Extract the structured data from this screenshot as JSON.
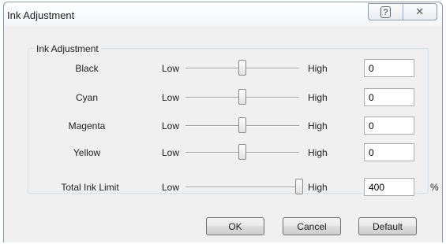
{
  "window": {
    "title": "Ink Adjustment",
    "help_button_glyph": "?",
    "close_button_glyph": "✕"
  },
  "group": {
    "label": "Ink Adjustment"
  },
  "rows": [
    {
      "label": "Black",
      "low": "Low",
      "high": "High",
      "value": "0",
      "slider_level": 0.5
    },
    {
      "label": "Cyan",
      "low": "Low",
      "high": "High",
      "value": "0",
      "slider_level": 0.5
    },
    {
      "label": "Magenta",
      "low": "Low",
      "high": "High",
      "value": "0",
      "slider_level": 0.5
    },
    {
      "label": "Yellow",
      "low": "Low",
      "high": "High",
      "value": "0",
      "slider_level": 0.5
    }
  ],
  "total": {
    "label": "Total Ink Limit",
    "low": "Low",
    "high": "High",
    "value": "400",
    "unit": "%",
    "slider_level": 1.0
  },
  "buttons": {
    "ok": "OK",
    "cancel": "Cancel",
    "default": "Default"
  }
}
